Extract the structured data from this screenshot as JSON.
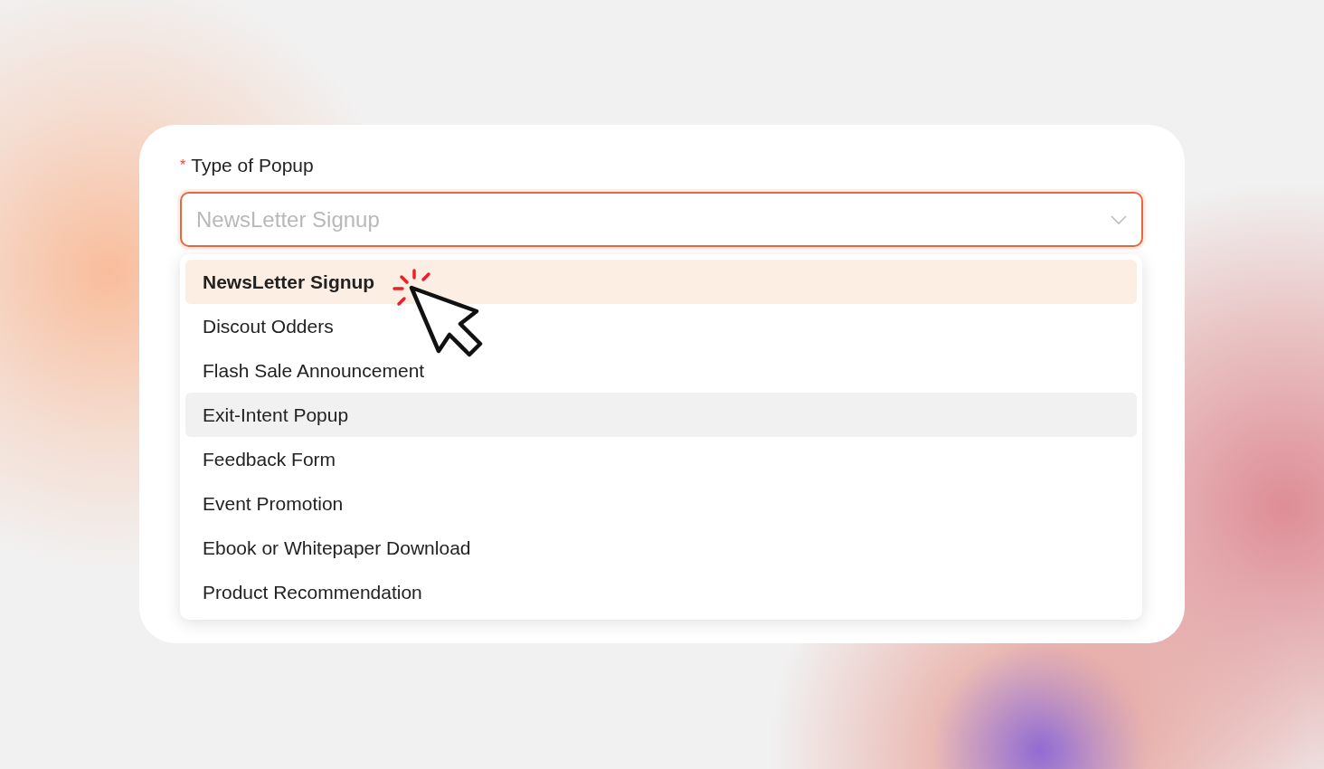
{
  "field": {
    "label": "Type of Popup",
    "required_mark": "*",
    "placeholder": "NewsLetter Signup",
    "focused": true,
    "expanded": true
  },
  "options": [
    {
      "label": "NewsLetter Signup",
      "selected": true,
      "hovered": false
    },
    {
      "label": "Discout Odders",
      "selected": false,
      "hovered": false
    },
    {
      "label": "Flash Sale Announcement",
      "selected": false,
      "hovered": false
    },
    {
      "label": "Exit-Intent Popup",
      "selected": false,
      "hovered": true
    },
    {
      "label": "Feedback Form",
      "selected": false,
      "hovered": false
    },
    {
      "label": "Event Promotion",
      "selected": false,
      "hovered": false
    },
    {
      "label": "Ebook or Whitepaper Download",
      "selected": false,
      "hovered": false
    },
    {
      "label": "Product Recommendation",
      "selected": false,
      "hovered": false
    }
  ]
}
